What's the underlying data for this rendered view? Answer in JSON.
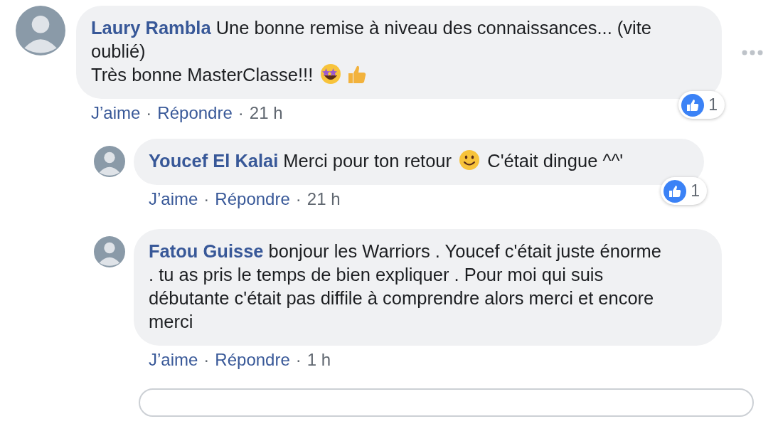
{
  "comments": [
    {
      "author": "Laury Rambla",
      "paragraphs": [
        [
          {
            "kind": "text",
            "text": "Une bonne remise à niveau des connaissances... (vite oublié)"
          }
        ],
        [
          {
            "kind": "text",
            "text": "Très bonne MasterClasse!!! "
          },
          {
            "kind": "starstruck"
          },
          {
            "kind": "thumbsup"
          }
        ]
      ],
      "reactions": "1",
      "actions": [
        "J’aime",
        "Répondre"
      ],
      "separator": "·",
      "time": "21 h",
      "more": true,
      "replies": [
        {
          "author": "Youcef El Kalai",
          "paragraphs": [
            [
              {
                "kind": "text",
                "text": "Merci pour ton retour "
              },
              {
                "kind": "smile"
              },
              {
                "kind": "text",
                "text": " C'était dingue ^^'"
              }
            ]
          ],
          "reactions": "1",
          "actions": [
            "J’aime",
            "Répondre"
          ],
          "separator": "·",
          "time": "21 h"
        },
        {
          "author": "Fatou Guisse",
          "paragraphs": [
            [
              {
                "kind": "text",
                "text": "bonjour les Warriors . Youcef c'était juste énorme . tu as pris le temps de bien expliquer . Pour moi qui suis débutante c'était pas diffile à comprendre alors merci et encore merci"
              }
            ]
          ],
          "actions": [
            "J’aime",
            "Répondre"
          ],
          "separator": "·",
          "time": "1 h"
        }
      ]
    }
  ]
}
